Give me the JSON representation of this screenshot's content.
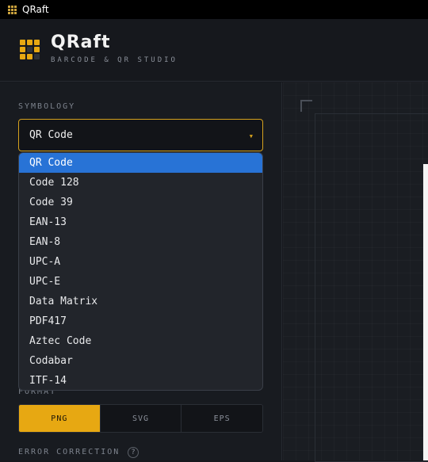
{
  "window": {
    "title": "QRaft"
  },
  "header": {
    "brand": "QRaft",
    "tagline": "BARCODE & QR STUDIO"
  },
  "symbology": {
    "label": "SYMBOLOGY",
    "selected": "QR Code",
    "options": [
      "QR Code",
      "Code 128",
      "Code 39",
      "EAN-13",
      "EAN-8",
      "UPC-A",
      "UPC-E",
      "Data Matrix",
      "PDF417",
      "Aztec Code",
      "Codabar",
      "ITF-14"
    ]
  },
  "format": {
    "label": "FORMAT",
    "options": [
      "PNG",
      "SVG",
      "EPS"
    ],
    "active": "PNG"
  },
  "error_correction": {
    "label": "ERROR CORRECTION",
    "help": "?"
  },
  "colors": {
    "accent": "#e7a812",
    "highlight": "#2873d6",
    "background": "#16181d"
  },
  "icons": [
    "app-grid-icon",
    "logo-grid-icon",
    "chevron-down-icon",
    "help-icon"
  ]
}
